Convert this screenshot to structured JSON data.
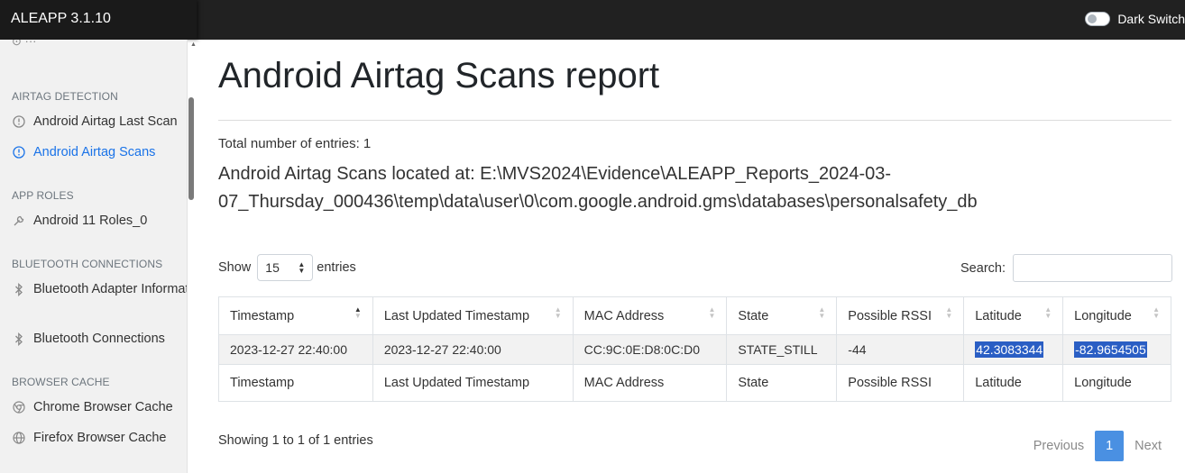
{
  "app": {
    "title": "ALEAPP 3.1.10",
    "dark_switch_label": "Dark Switch"
  },
  "sidebar": {
    "sections": [
      {
        "heading": "AIRTAG DETECTION",
        "items": [
          {
            "label": "Android Airtag Last Scan",
            "icon": "alert-circle-icon",
            "active": false
          },
          {
            "label": "Android Airtag Scans",
            "icon": "alert-circle-icon",
            "active": true
          }
        ]
      },
      {
        "heading": "APP ROLES",
        "items": [
          {
            "label": "Android 11 Roles_0",
            "icon": "tool-icon",
            "active": false
          }
        ]
      },
      {
        "heading": "BLUETOOTH CONNECTIONS",
        "items": [
          {
            "label": "Bluetooth Adapter Informati",
            "icon": "bluetooth-icon",
            "active": false
          },
          {
            "label": "Bluetooth Connections",
            "icon": "bluetooth-icon",
            "active": false
          }
        ]
      },
      {
        "heading": "BROWSER CACHE",
        "items": [
          {
            "label": "Chrome Browser Cache",
            "icon": "chrome-icon",
            "active": false
          },
          {
            "label": "Firefox Browser Cache",
            "icon": "globe-icon",
            "active": false
          }
        ]
      }
    ]
  },
  "report": {
    "title": "Android Airtag Scans report",
    "total": "Total number of entries: 1",
    "located": "Android Airtag Scans located at: E:\\MVS2024\\Evidence\\ALEAPP_Reports_2024-03-07_Thursday_000436\\temp\\data\\user\\0\\com.google.android.gms\\databases\\personalsafety_db"
  },
  "controls": {
    "show_label": "Show",
    "page_length": "15",
    "entries_label": "entries",
    "search_label": "Search:",
    "search_value": ""
  },
  "table": {
    "columns": [
      "Timestamp",
      "Last Updated Timestamp",
      "MAC Address",
      "State",
      "Possible RSSI",
      "Latitude",
      "Longitude"
    ],
    "rows": [
      [
        "2023-12-27 22:40:00",
        "2023-12-27 22:40:00",
        "CC:9C:0E:D8:0C:D0",
        "STATE_STILL",
        "-44",
        "42.3083344",
        "-82.9654505"
      ]
    ]
  },
  "footer": {
    "info": "Showing 1 to 1 of 1 entries",
    "prev": "Previous",
    "current_page": "1",
    "next": "Next"
  },
  "colors": {
    "accent": "#1a73e8",
    "highlight": "#2a5ec4",
    "page_button": "#4a90e2",
    "topbar": "#212121"
  }
}
